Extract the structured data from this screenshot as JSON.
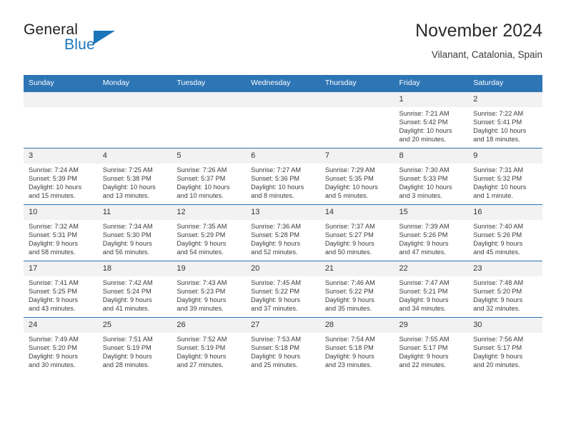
{
  "brand": {
    "word_one": "General",
    "word_two": "Blue",
    "logo_icon": "triangle-logo-icon",
    "accent_color": "#1b75bb"
  },
  "header": {
    "title": "November 2024",
    "subtitle": "Vilanant, Catalonia, Spain"
  },
  "theme": {
    "header_row_color": "#2e75b6",
    "daynum_background": "#f2f2f2",
    "grid_line_color": "#2e75b6"
  },
  "weekdays": [
    "Sunday",
    "Monday",
    "Tuesday",
    "Wednesday",
    "Thursday",
    "Friday",
    "Saturday"
  ],
  "weeks": [
    [
      {
        "day": "",
        "blank": true
      },
      {
        "day": "",
        "blank": true
      },
      {
        "day": "",
        "blank": true
      },
      {
        "day": "",
        "blank": true
      },
      {
        "day": "",
        "blank": true
      },
      {
        "day": "1",
        "sunrise": "Sunrise: 7:21 AM",
        "sunset": "Sunset: 5:42 PM",
        "daylight_1": "Daylight: 10 hours",
        "daylight_2": "and 20 minutes."
      },
      {
        "day": "2",
        "sunrise": "Sunrise: 7:22 AM",
        "sunset": "Sunset: 5:41 PM",
        "daylight_1": "Daylight: 10 hours",
        "daylight_2": "and 18 minutes."
      }
    ],
    [
      {
        "day": "3",
        "sunrise": "Sunrise: 7:24 AM",
        "sunset": "Sunset: 5:39 PM",
        "daylight_1": "Daylight: 10 hours",
        "daylight_2": "and 15 minutes."
      },
      {
        "day": "4",
        "sunrise": "Sunrise: 7:25 AM",
        "sunset": "Sunset: 5:38 PM",
        "daylight_1": "Daylight: 10 hours",
        "daylight_2": "and 13 minutes."
      },
      {
        "day": "5",
        "sunrise": "Sunrise: 7:26 AM",
        "sunset": "Sunset: 5:37 PM",
        "daylight_1": "Daylight: 10 hours",
        "daylight_2": "and 10 minutes."
      },
      {
        "day": "6",
        "sunrise": "Sunrise: 7:27 AM",
        "sunset": "Sunset: 5:36 PM",
        "daylight_1": "Daylight: 10 hours",
        "daylight_2": "and 8 minutes."
      },
      {
        "day": "7",
        "sunrise": "Sunrise: 7:29 AM",
        "sunset": "Sunset: 5:35 PM",
        "daylight_1": "Daylight: 10 hours",
        "daylight_2": "and 5 minutes."
      },
      {
        "day": "8",
        "sunrise": "Sunrise: 7:30 AM",
        "sunset": "Sunset: 5:33 PM",
        "daylight_1": "Daylight: 10 hours",
        "daylight_2": "and 3 minutes."
      },
      {
        "day": "9",
        "sunrise": "Sunrise: 7:31 AM",
        "sunset": "Sunset: 5:32 PM",
        "daylight_1": "Daylight: 10 hours",
        "daylight_2": "and 1 minute."
      }
    ],
    [
      {
        "day": "10",
        "sunrise": "Sunrise: 7:32 AM",
        "sunset": "Sunset: 5:31 PM",
        "daylight_1": "Daylight: 9 hours",
        "daylight_2": "and 58 minutes."
      },
      {
        "day": "11",
        "sunrise": "Sunrise: 7:34 AM",
        "sunset": "Sunset: 5:30 PM",
        "daylight_1": "Daylight: 9 hours",
        "daylight_2": "and 56 minutes."
      },
      {
        "day": "12",
        "sunrise": "Sunrise: 7:35 AM",
        "sunset": "Sunset: 5:29 PM",
        "daylight_1": "Daylight: 9 hours",
        "daylight_2": "and 54 minutes."
      },
      {
        "day": "13",
        "sunrise": "Sunrise: 7:36 AM",
        "sunset": "Sunset: 5:28 PM",
        "daylight_1": "Daylight: 9 hours",
        "daylight_2": "and 52 minutes."
      },
      {
        "day": "14",
        "sunrise": "Sunrise: 7:37 AM",
        "sunset": "Sunset: 5:27 PM",
        "daylight_1": "Daylight: 9 hours",
        "daylight_2": "and 50 minutes."
      },
      {
        "day": "15",
        "sunrise": "Sunrise: 7:39 AM",
        "sunset": "Sunset: 5:26 PM",
        "daylight_1": "Daylight: 9 hours",
        "daylight_2": "and 47 minutes."
      },
      {
        "day": "16",
        "sunrise": "Sunrise: 7:40 AM",
        "sunset": "Sunset: 5:26 PM",
        "daylight_1": "Daylight: 9 hours",
        "daylight_2": "and 45 minutes."
      }
    ],
    [
      {
        "day": "17",
        "sunrise": "Sunrise: 7:41 AM",
        "sunset": "Sunset: 5:25 PM",
        "daylight_1": "Daylight: 9 hours",
        "daylight_2": "and 43 minutes."
      },
      {
        "day": "18",
        "sunrise": "Sunrise: 7:42 AM",
        "sunset": "Sunset: 5:24 PM",
        "daylight_1": "Daylight: 9 hours",
        "daylight_2": "and 41 minutes."
      },
      {
        "day": "19",
        "sunrise": "Sunrise: 7:43 AM",
        "sunset": "Sunset: 5:23 PM",
        "daylight_1": "Daylight: 9 hours",
        "daylight_2": "and 39 minutes."
      },
      {
        "day": "20",
        "sunrise": "Sunrise: 7:45 AM",
        "sunset": "Sunset: 5:22 PM",
        "daylight_1": "Daylight: 9 hours",
        "daylight_2": "and 37 minutes."
      },
      {
        "day": "21",
        "sunrise": "Sunrise: 7:46 AM",
        "sunset": "Sunset: 5:22 PM",
        "daylight_1": "Daylight: 9 hours",
        "daylight_2": "and 35 minutes."
      },
      {
        "day": "22",
        "sunrise": "Sunrise: 7:47 AM",
        "sunset": "Sunset: 5:21 PM",
        "daylight_1": "Daylight: 9 hours",
        "daylight_2": "and 34 minutes."
      },
      {
        "day": "23",
        "sunrise": "Sunrise: 7:48 AM",
        "sunset": "Sunset: 5:20 PM",
        "daylight_1": "Daylight: 9 hours",
        "daylight_2": "and 32 minutes."
      }
    ],
    [
      {
        "day": "24",
        "sunrise": "Sunrise: 7:49 AM",
        "sunset": "Sunset: 5:20 PM",
        "daylight_1": "Daylight: 9 hours",
        "daylight_2": "and 30 minutes."
      },
      {
        "day": "25",
        "sunrise": "Sunrise: 7:51 AM",
        "sunset": "Sunset: 5:19 PM",
        "daylight_1": "Daylight: 9 hours",
        "daylight_2": "and 28 minutes."
      },
      {
        "day": "26",
        "sunrise": "Sunrise: 7:52 AM",
        "sunset": "Sunset: 5:19 PM",
        "daylight_1": "Daylight: 9 hours",
        "daylight_2": "and 27 minutes."
      },
      {
        "day": "27",
        "sunrise": "Sunrise: 7:53 AM",
        "sunset": "Sunset: 5:18 PM",
        "daylight_1": "Daylight: 9 hours",
        "daylight_2": "and 25 minutes."
      },
      {
        "day": "28",
        "sunrise": "Sunrise: 7:54 AM",
        "sunset": "Sunset: 5:18 PM",
        "daylight_1": "Daylight: 9 hours",
        "daylight_2": "and 23 minutes."
      },
      {
        "day": "29",
        "sunrise": "Sunrise: 7:55 AM",
        "sunset": "Sunset: 5:17 PM",
        "daylight_1": "Daylight: 9 hours",
        "daylight_2": "and 22 minutes."
      },
      {
        "day": "30",
        "sunrise": "Sunrise: 7:56 AM",
        "sunset": "Sunset: 5:17 PM",
        "daylight_1": "Daylight: 9 hours",
        "daylight_2": "and 20 minutes."
      }
    ]
  ]
}
